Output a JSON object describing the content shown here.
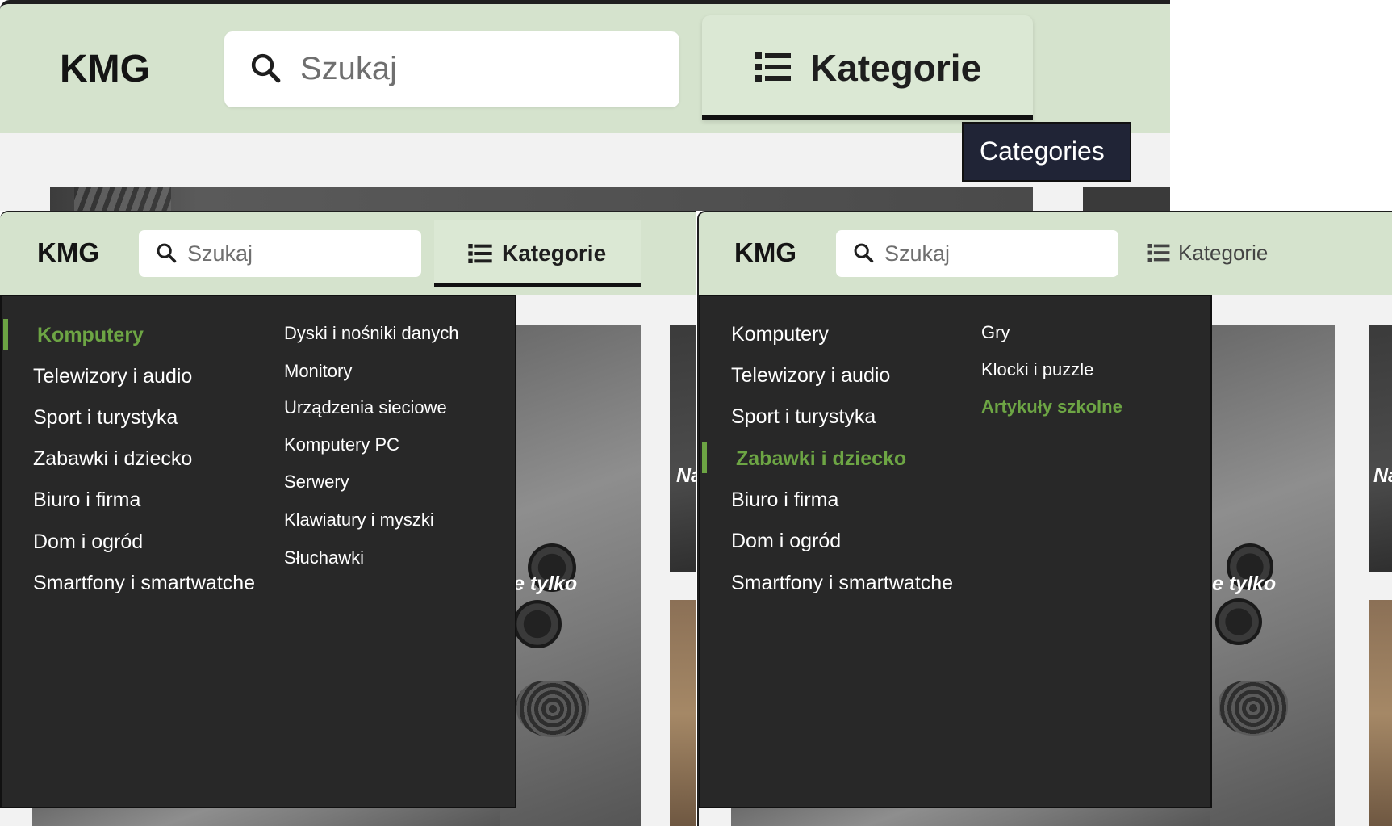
{
  "logo": "KMG",
  "search": {
    "placeholder": "Szukaj"
  },
  "categories_button": {
    "label": "Kategorie"
  },
  "tooltip": {
    "text": "Categories"
  },
  "menu": {
    "categories": [
      "Komputery",
      "Telewizory i audio",
      "Sport i turystyka",
      "Zabawki i dziecko",
      "Biuro i firma",
      "Dom i ogród",
      "Smartfony i smartwatche"
    ],
    "left_panel": {
      "active_category": "Komputery",
      "subcategories": [
        "Dyski i nośniki danych",
        "Monitory",
        "Urządzenia sieciowe",
        "Komputery PC",
        "Serwery",
        "Klawiatury i myszki",
        "Słuchawki"
      ]
    },
    "right_panel": {
      "active_category": "Zabawki i dziecko",
      "subcategories": [
        "Gry",
        "Klocki i puzzle",
        "Artykuły szkolne"
      ],
      "hovered_subcategory": "Artykuły szkolne"
    }
  },
  "banner_text_fragment": "e tylko",
  "banner_side_fragment": "Na",
  "colors": {
    "header_bg": "#d5e3cd",
    "accent_green": "#6da544",
    "menu_bg": "#282828",
    "tooltip_bg": "#202436"
  },
  "icons": [
    "search-icon",
    "list-icon"
  ]
}
